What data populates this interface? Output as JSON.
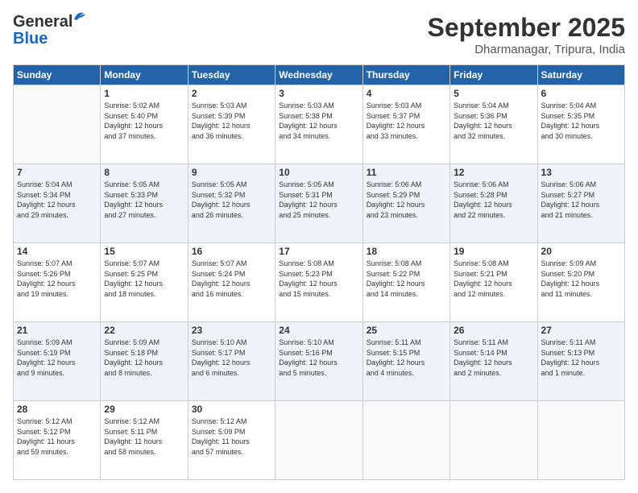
{
  "logo": {
    "general": "General",
    "blue": "Blue"
  },
  "header": {
    "month": "September 2025",
    "location": "Dharmanagar, Tripura, India"
  },
  "weekdays": [
    "Sunday",
    "Monday",
    "Tuesday",
    "Wednesday",
    "Thursday",
    "Friday",
    "Saturday"
  ],
  "weeks": [
    [
      {
        "day": "",
        "info": ""
      },
      {
        "day": "1",
        "info": "Sunrise: 5:02 AM\nSunset: 5:40 PM\nDaylight: 12 hours\nand 37 minutes."
      },
      {
        "day": "2",
        "info": "Sunrise: 5:03 AM\nSunset: 5:39 PM\nDaylight: 12 hours\nand 36 minutes."
      },
      {
        "day": "3",
        "info": "Sunrise: 5:03 AM\nSunset: 5:38 PM\nDaylight: 12 hours\nand 34 minutes."
      },
      {
        "day": "4",
        "info": "Sunrise: 5:03 AM\nSunset: 5:37 PM\nDaylight: 12 hours\nand 33 minutes."
      },
      {
        "day": "5",
        "info": "Sunrise: 5:04 AM\nSunset: 5:36 PM\nDaylight: 12 hours\nand 32 minutes."
      },
      {
        "day": "6",
        "info": "Sunrise: 5:04 AM\nSunset: 5:35 PM\nDaylight: 12 hours\nand 30 minutes."
      }
    ],
    [
      {
        "day": "7",
        "info": "Sunrise: 5:04 AM\nSunset: 5:34 PM\nDaylight: 12 hours\nand 29 minutes."
      },
      {
        "day": "8",
        "info": "Sunrise: 5:05 AM\nSunset: 5:33 PM\nDaylight: 12 hours\nand 27 minutes."
      },
      {
        "day": "9",
        "info": "Sunrise: 5:05 AM\nSunset: 5:32 PM\nDaylight: 12 hours\nand 26 minutes."
      },
      {
        "day": "10",
        "info": "Sunrise: 5:05 AM\nSunset: 5:31 PM\nDaylight: 12 hours\nand 25 minutes."
      },
      {
        "day": "11",
        "info": "Sunrise: 5:06 AM\nSunset: 5:29 PM\nDaylight: 12 hours\nand 23 minutes."
      },
      {
        "day": "12",
        "info": "Sunrise: 5:06 AM\nSunset: 5:28 PM\nDaylight: 12 hours\nand 22 minutes."
      },
      {
        "day": "13",
        "info": "Sunrise: 5:06 AM\nSunset: 5:27 PM\nDaylight: 12 hours\nand 21 minutes."
      }
    ],
    [
      {
        "day": "14",
        "info": "Sunrise: 5:07 AM\nSunset: 5:26 PM\nDaylight: 12 hours\nand 19 minutes."
      },
      {
        "day": "15",
        "info": "Sunrise: 5:07 AM\nSunset: 5:25 PM\nDaylight: 12 hours\nand 18 minutes."
      },
      {
        "day": "16",
        "info": "Sunrise: 5:07 AM\nSunset: 5:24 PM\nDaylight: 12 hours\nand 16 minutes."
      },
      {
        "day": "17",
        "info": "Sunrise: 5:08 AM\nSunset: 5:23 PM\nDaylight: 12 hours\nand 15 minutes."
      },
      {
        "day": "18",
        "info": "Sunrise: 5:08 AM\nSunset: 5:22 PM\nDaylight: 12 hours\nand 14 minutes."
      },
      {
        "day": "19",
        "info": "Sunrise: 5:08 AM\nSunset: 5:21 PM\nDaylight: 12 hours\nand 12 minutes."
      },
      {
        "day": "20",
        "info": "Sunrise: 5:09 AM\nSunset: 5:20 PM\nDaylight: 12 hours\nand 11 minutes."
      }
    ],
    [
      {
        "day": "21",
        "info": "Sunrise: 5:09 AM\nSunset: 5:19 PM\nDaylight: 12 hours\nand 9 minutes."
      },
      {
        "day": "22",
        "info": "Sunrise: 5:09 AM\nSunset: 5:18 PM\nDaylight: 12 hours\nand 8 minutes."
      },
      {
        "day": "23",
        "info": "Sunrise: 5:10 AM\nSunset: 5:17 PM\nDaylight: 12 hours\nand 6 minutes."
      },
      {
        "day": "24",
        "info": "Sunrise: 5:10 AM\nSunset: 5:16 PM\nDaylight: 12 hours\nand 5 minutes."
      },
      {
        "day": "25",
        "info": "Sunrise: 5:11 AM\nSunset: 5:15 PM\nDaylight: 12 hours\nand 4 minutes."
      },
      {
        "day": "26",
        "info": "Sunrise: 5:11 AM\nSunset: 5:14 PM\nDaylight: 12 hours\nand 2 minutes."
      },
      {
        "day": "27",
        "info": "Sunrise: 5:11 AM\nSunset: 5:13 PM\nDaylight: 12 hours\nand 1 minute."
      }
    ],
    [
      {
        "day": "28",
        "info": "Sunrise: 5:12 AM\nSunset: 5:12 PM\nDaylight: 11 hours\nand 59 minutes."
      },
      {
        "day": "29",
        "info": "Sunrise: 5:12 AM\nSunset: 5:11 PM\nDaylight: 11 hours\nand 58 minutes."
      },
      {
        "day": "30",
        "info": "Sunrise: 5:12 AM\nSunset: 5:09 PM\nDaylight: 11 hours\nand 57 minutes."
      },
      {
        "day": "",
        "info": ""
      },
      {
        "day": "",
        "info": ""
      },
      {
        "day": "",
        "info": ""
      },
      {
        "day": "",
        "info": ""
      }
    ]
  ]
}
